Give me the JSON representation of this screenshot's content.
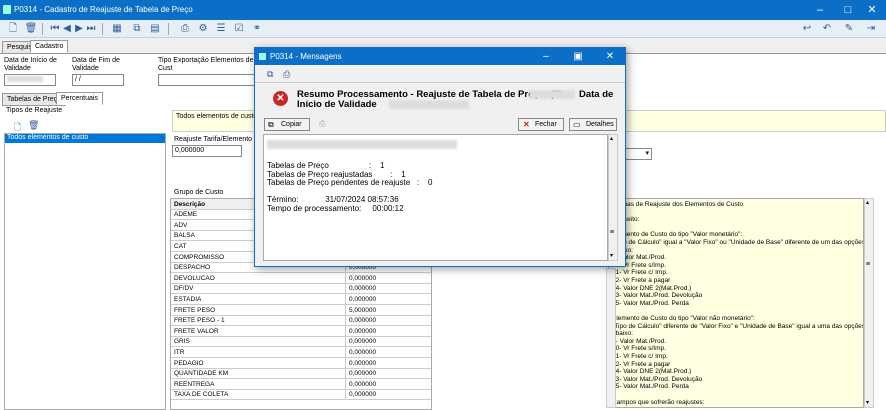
{
  "window": {
    "title": "P0314 - Cadastro de Reajuste de Tabela de Preço"
  },
  "tabs": [
    "Pesquisa",
    "Cadastro"
  ],
  "fields": {
    "data_inicio_label": "Data de Início de Validade",
    "data_fim_label": "Data de Fim de Validade",
    "data_fim_value": " / /",
    "tipo_exportacao_label": "Tipo Exportação Elementos de Cust"
  },
  "subtabs": [
    "Tabelas de Preço",
    "Percentuais"
  ],
  "tipos": {
    "group_label": "Tipos de Reajuste",
    "selected_item": "Todos elementos de custo",
    "panel_label": "Todos elementos de custo",
    "reajuste_label": "Reajuste Tarifa/Elemento de",
    "reajuste_value": "0,000000"
  },
  "grupo": {
    "label": "Grupo de Custo",
    "col_descricao": "Descrição",
    "rows": [
      {
        "desc": "ADEME",
        "val": ""
      },
      {
        "desc": "ADV",
        "val": ""
      },
      {
        "desc": "BALSA",
        "val": ""
      },
      {
        "desc": "CAT",
        "val": ""
      },
      {
        "desc": "COMPROMISSO",
        "val": ""
      },
      {
        "desc": "DESPACHO",
        "val": "0,000000"
      },
      {
        "desc": "DEVOLUCAO",
        "val": "0,000000"
      },
      {
        "desc": "DF/DV",
        "val": "0,000000"
      },
      {
        "desc": "ESTADIA",
        "val": "0,000000"
      },
      {
        "desc": "FRETE PESO",
        "val": "5,000000"
      },
      {
        "desc": "FRETE PESO - 1",
        "val": "0,000000"
      },
      {
        "desc": "FRETE VALOR",
        "val": "0,000000"
      },
      {
        "desc": "GRIS",
        "val": "0,000000"
      },
      {
        "desc": "ITR",
        "val": "0,000000"
      },
      {
        "desc": "PEDAGIO",
        "val": "0,000000"
      },
      {
        "desc": "QUANTIDADE KM",
        "val": "0,000000"
      },
      {
        "desc": "REENTREGA",
        "val": "0,000000"
      },
      {
        "desc": "TAXA DE COLETA",
        "val": "0,000000"
      }
    ]
  },
  "notes": {
    "lines": [
      "Formas de Reajuste dos Elementos de Custo",
      "",
      "Conceito:",
      "",
      "Elemento de Custo do tipo \"Valor monetário\":",
      "\"Tipo de Cálculo\" igual a \"Valor Fixo\" ou \"Unidade de Base\" diferente de um das opções",
      "abaixo:",
      "1- Valor Mat./Prod.",
      "20- Vr Frete s/Imp.",
      "21- Vr Frete c/ Imp.",
      "22- Vr Frete a pagar",
      "44- Valor DNE 2(Mat.Prod.)",
      "53- Valor Mat./Prod. Devolução",
      "55- Valor Mat./Prod. Perda",
      "",
      "Elemento de Custo do tipo \"Valor não monetário\":",
      "\"Tipo de Cálculo\" diferente de \"Valor Fixo\" e \"Unidade de Base\" igual a uma das opções",
      "abaixo:",
      "1- Valor Mat./Prod.",
      "20- Vr Frete s/Imp.",
      "21- Vr Frete c/ Imp.",
      "22- Vr Frete a pagar",
      "44- Valor DNE 2(Mat.Prod.)",
      "53- Valor Mat./Prod. Devolução",
      "55- Valor Mat./Prod. Perda",
      "",
      "Campos que sofrerão reajustes:"
    ]
  },
  "dialog": {
    "title": "P0314 - Mensagens",
    "heading_1": "Resumo Processamento - Reajuste de Tabela de Preço: (ID",
    "heading_1b": "Data de",
    "heading_2": "Início de Validade",
    "copy_label": "Copiar",
    "close_label": "Fechar",
    "details_label": "Detalhes",
    "lines": [
      "Tabelas de Preço                  :    1",
      "Tabelas de Preço reajustadas        :    1",
      "Tabelas de Preço pendentes de reajuste   :    0",
      "",
      "Término:            31/07/2024 08:57:36",
      "Tempo de processamento:     00:00:12"
    ]
  }
}
